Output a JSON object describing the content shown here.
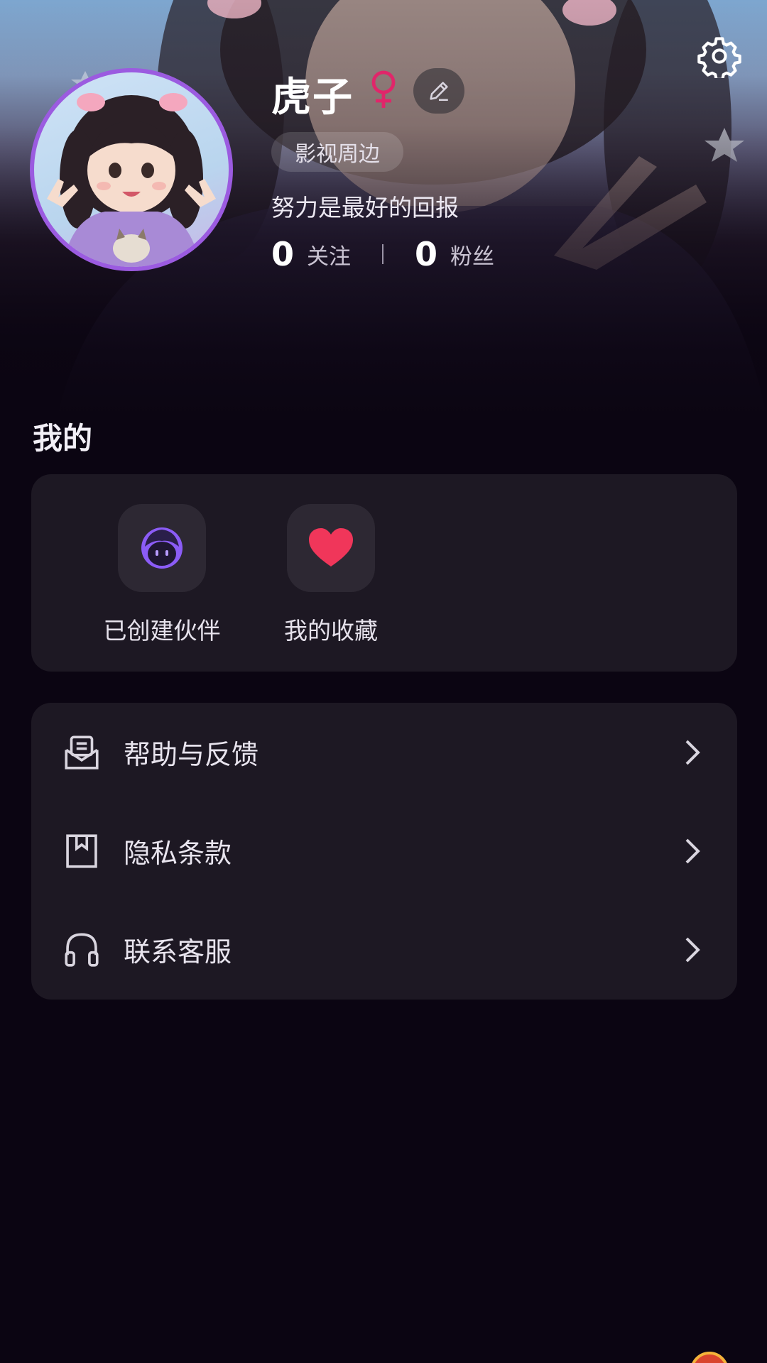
{
  "header": {
    "settings_icon": "gear-icon",
    "edit_icon": "pencil-icon",
    "gender_icon": "female-symbol-icon",
    "gender_color": "#e0266a"
  },
  "profile": {
    "name": "虎子",
    "tag": "影视周边",
    "bio": "努力是最好的回报",
    "following_count": "0",
    "following_label": "关注",
    "followers_count": "0",
    "followers_label": "粉丝"
  },
  "section": {
    "title": "我的"
  },
  "quick_actions": [
    {
      "label": "已创建伙伴",
      "icon": "partner-face-icon",
      "color": "#8b5cf6"
    },
    {
      "label": "我的收藏",
      "icon": "heart-icon",
      "color": "#f0365a"
    }
  ],
  "menu": [
    {
      "label": "帮助与反馈",
      "icon": "mail-feedback-icon"
    },
    {
      "label": "隐私条款",
      "icon": "bookmark-document-icon"
    },
    {
      "label": "联系客服",
      "icon": "headset-icon"
    }
  ],
  "colors": {
    "background": "#0b0512",
    "card": "#1d1823",
    "avatar_border": "#9b5be0"
  }
}
